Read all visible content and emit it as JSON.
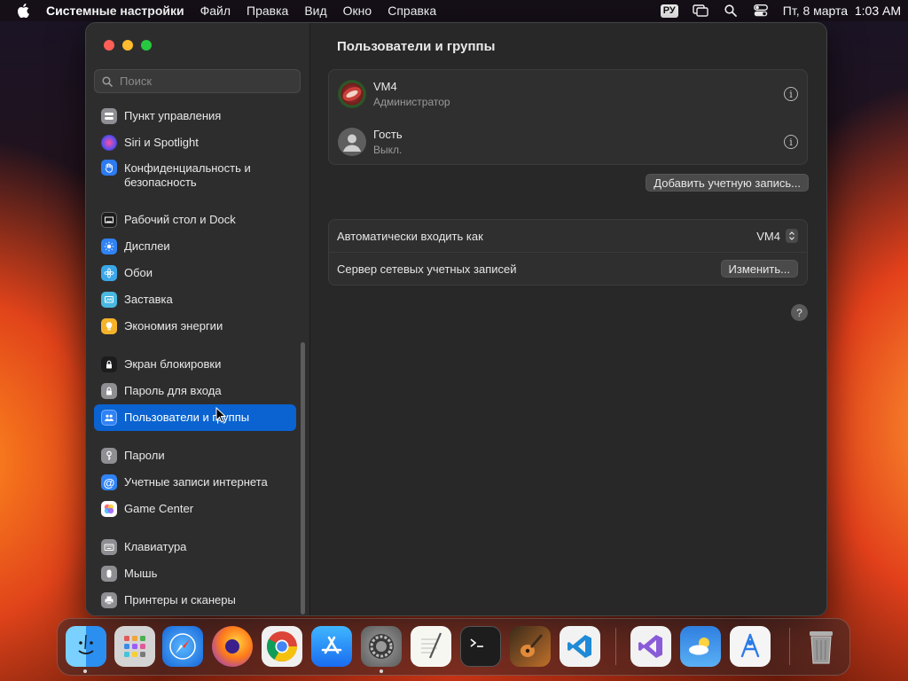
{
  "menubar": {
    "app_name": "Системные настройки",
    "items": [
      "Файл",
      "Правка",
      "Вид",
      "Окно",
      "Справка"
    ],
    "lang": "РУ",
    "datetime": "Пт, 8 марта  1:03 AM"
  },
  "sidebar": {
    "search_placeholder": "Поиск",
    "items": [
      {
        "label": "Пункт управления",
        "icon": "control-center-icon",
        "color": "#8e8e93"
      },
      {
        "label": "Siri и Spotlight",
        "icon": "siri-icon",
        "color": "#c04fd8"
      },
      {
        "label": "Конфиденциальность и безопасность",
        "icon": "privacy-hand-icon",
        "color": "#2c7bf2"
      },
      {
        "label": "Рабочий стол и Dock",
        "icon": "desktop-dock-icon",
        "color": "#1c1c1e"
      },
      {
        "label": "Дисплеи",
        "icon": "display-icon",
        "color": "#2f83f7"
      },
      {
        "label": "Обои",
        "icon": "wallpaper-icon",
        "color": "#3aa7e8"
      },
      {
        "label": "Заставка",
        "icon": "screensaver-icon",
        "color": "#4ab8e0"
      },
      {
        "label": "Экономия энергии",
        "icon": "energy-bulb-icon",
        "color": "#f5b32a"
      },
      {
        "label": "Экран блокировки",
        "icon": "lock-screen-icon",
        "color": "#1c1c1e"
      },
      {
        "label": "Пароль для входа",
        "icon": "login-password-lock-icon",
        "color": "#8e8e93"
      },
      {
        "label": "Пользователи и группы",
        "icon": "users-groups-icon",
        "color": "#2f83f7"
      },
      {
        "label": "Пароли",
        "icon": "passwords-key-icon",
        "color": "#8e8e93"
      },
      {
        "label": "Учетные записи интернета",
        "icon": "internet-accounts-at-icon",
        "color": "#2f83f7"
      },
      {
        "label": "Game Center",
        "icon": "game-center-icon",
        "color": "#ffffff"
      },
      {
        "label": "Клавиатура",
        "icon": "keyboard-icon",
        "color": "#8e8e93"
      },
      {
        "label": "Мышь",
        "icon": "mouse-icon",
        "color": "#8e8e93"
      },
      {
        "label": "Принтеры и сканеры",
        "icon": "printer-icon",
        "color": "#8e8e93"
      }
    ],
    "selected_index": 10
  },
  "main": {
    "title": "Пользователи и группы",
    "users": [
      {
        "name": "VM4",
        "role": "Администратор"
      },
      {
        "name": "Гость",
        "role": "Выкл."
      }
    ],
    "add_account_label": "Добавить учетную запись...",
    "auto_login_label": "Автоматически входить как",
    "auto_login_value": "VM4",
    "network_server_label": "Сервер сетевых учетных записей",
    "edit_label": "Изменить...",
    "help_glyph": "?"
  },
  "dock": {
    "apps": [
      {
        "name": "finder-icon",
        "color": "#3a9cf0",
        "running": true
      },
      {
        "name": "launchpad-icon",
        "color": "#c9c9c9",
        "running": false
      },
      {
        "name": "safari-icon",
        "color": "#2d8cf0",
        "running": false
      },
      {
        "name": "firefox-icon",
        "color": "#ff7a1a",
        "running": false
      },
      {
        "name": "chrome-icon",
        "color": "#ffffff",
        "running": false
      },
      {
        "name": "app-store-icon",
        "color": "#1e8cf5",
        "running": false
      },
      {
        "name": "system-settings-icon",
        "color": "#8a8a8a",
        "running": true
      },
      {
        "name": "textedit-icon",
        "color": "#f0f0f0",
        "running": false
      },
      {
        "name": "terminal-icon",
        "color": "#1a1a1a",
        "running": false
      },
      {
        "name": "garageband-icon",
        "color": "#6a3a1a",
        "running": false
      },
      {
        "name": "vscode-icon",
        "color": "#ffffff",
        "running": false
      },
      {
        "name": "visual-studio-icon",
        "color": "#ffffff",
        "running": false
      },
      {
        "name": "weather-icon",
        "color": "#3a8ee0",
        "running": false
      },
      {
        "name": "instruments-icon",
        "color": "#ffffff",
        "running": false
      },
      {
        "name": "trash-icon",
        "color": "#9a9a9a",
        "running": false
      }
    ]
  }
}
